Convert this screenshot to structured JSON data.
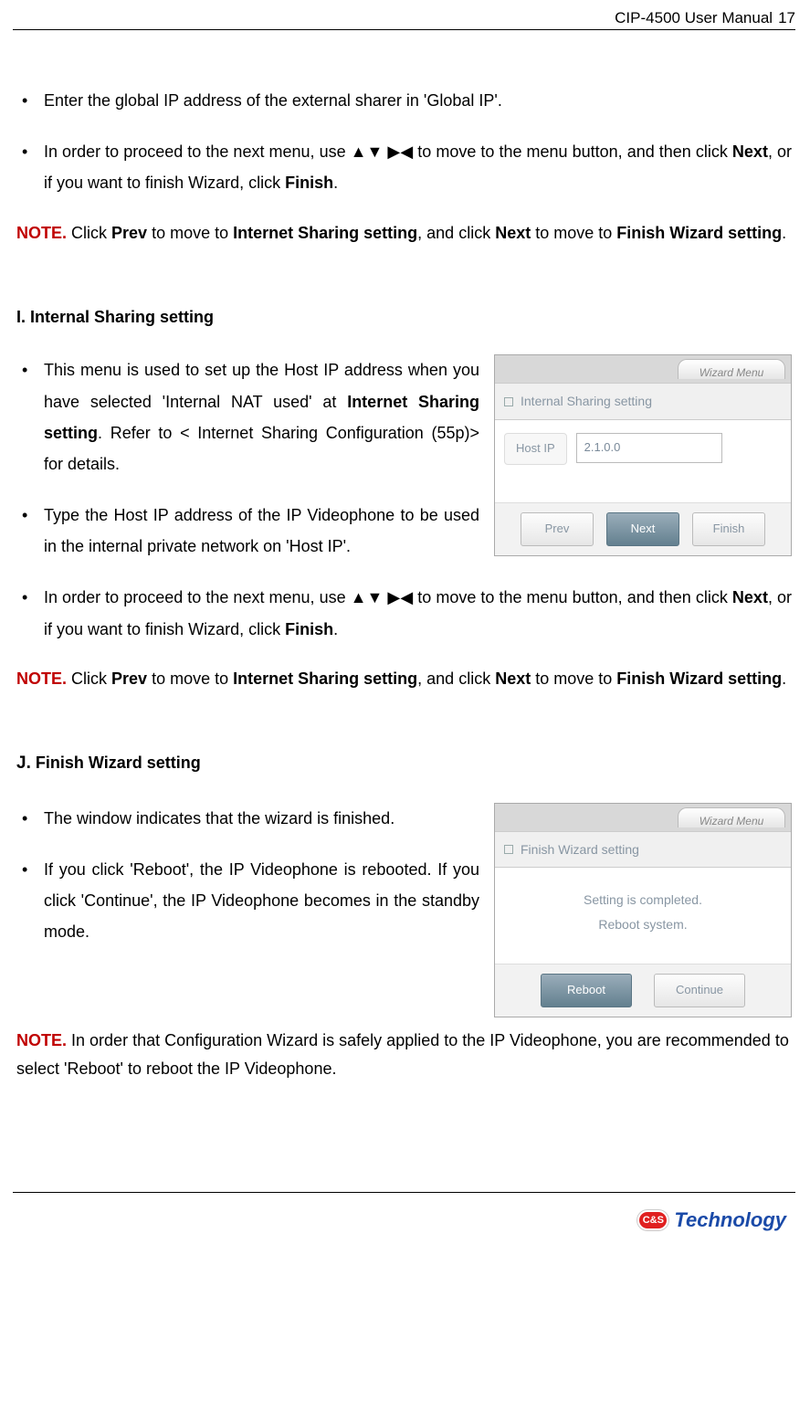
{
  "header": {
    "title": "CIP-4500 User Manual",
    "page": "17"
  },
  "intro_bullets": [
    "Enter the global IP address of the external sharer in 'Global IP'.",
    "In order to proceed to the next menu, use ▲▼ ▶◀ to move to the menu button, and then click <b>Next</b>, or if you want to finish Wizard, click <b>Finish</b>."
  ],
  "intro_note": {
    "label": "NOTE.",
    "text": "Click <b>Prev</b> to move to <b>Internet Sharing setting</b>, and click <b>Next</b> to move to <b>Finish Wizard setting</b>."
  },
  "section_i": {
    "heading": "I. Internal Sharing setting",
    "bullets": [
      "This menu is used to set up the Host IP address when you have selected 'Internal NAT used' at <b>Internet Sharing setting</b>. Refer to < Internet Sharing Configuration (55p)> for details.",
      "Type the Host IP address of the IP Videophone to be used in the internal private network on 'Host IP'.",
      "In order to proceed to the next menu, use ▲▼ ▶◀ to move to the menu button, and then click <b>Next</b>, or if you want to finish Wizard, click <b>Finish</b>."
    ],
    "note": {
      "label": "NOTE.",
      "text": "Click <b>Prev</b> to move to <b>Internet Sharing setting</b>, and click <b>Next</b> to move to <b>Finish Wizard setting</b>."
    },
    "figure": {
      "tab": "Wizard Menu",
      "title": "Internal Sharing setting",
      "field_label": "Host IP",
      "field_value": "2.1.0.0",
      "buttons": {
        "prev": "Prev",
        "next": "Next",
        "finish": "Finish"
      }
    }
  },
  "section_j": {
    "heading_prefix": "J.",
    "heading_rest": " Finish Wizard setting",
    "bullets": [
      "The window indicates that the wizard is finished.",
      "If you click 'Reboot', the IP Videophone is rebooted. If you click 'Continue', the IP Videophone becomes in the standby mode."
    ],
    "note": {
      "label": "NOTE.",
      "text": "In order that Configuration Wizard is safely applied to the IP Videophone, you are recommended to select 'Reboot' to reboot the IP Videophone."
    },
    "figure": {
      "tab": "Wizard Menu",
      "title": "Finish Wizard setting",
      "line1": "Setting is completed.",
      "line2": "Reboot system.",
      "buttons": {
        "reboot": "Reboot",
        "continue": "Continue"
      }
    }
  },
  "footer": {
    "logo_badge": "C&S",
    "logo_text": "Technology"
  }
}
